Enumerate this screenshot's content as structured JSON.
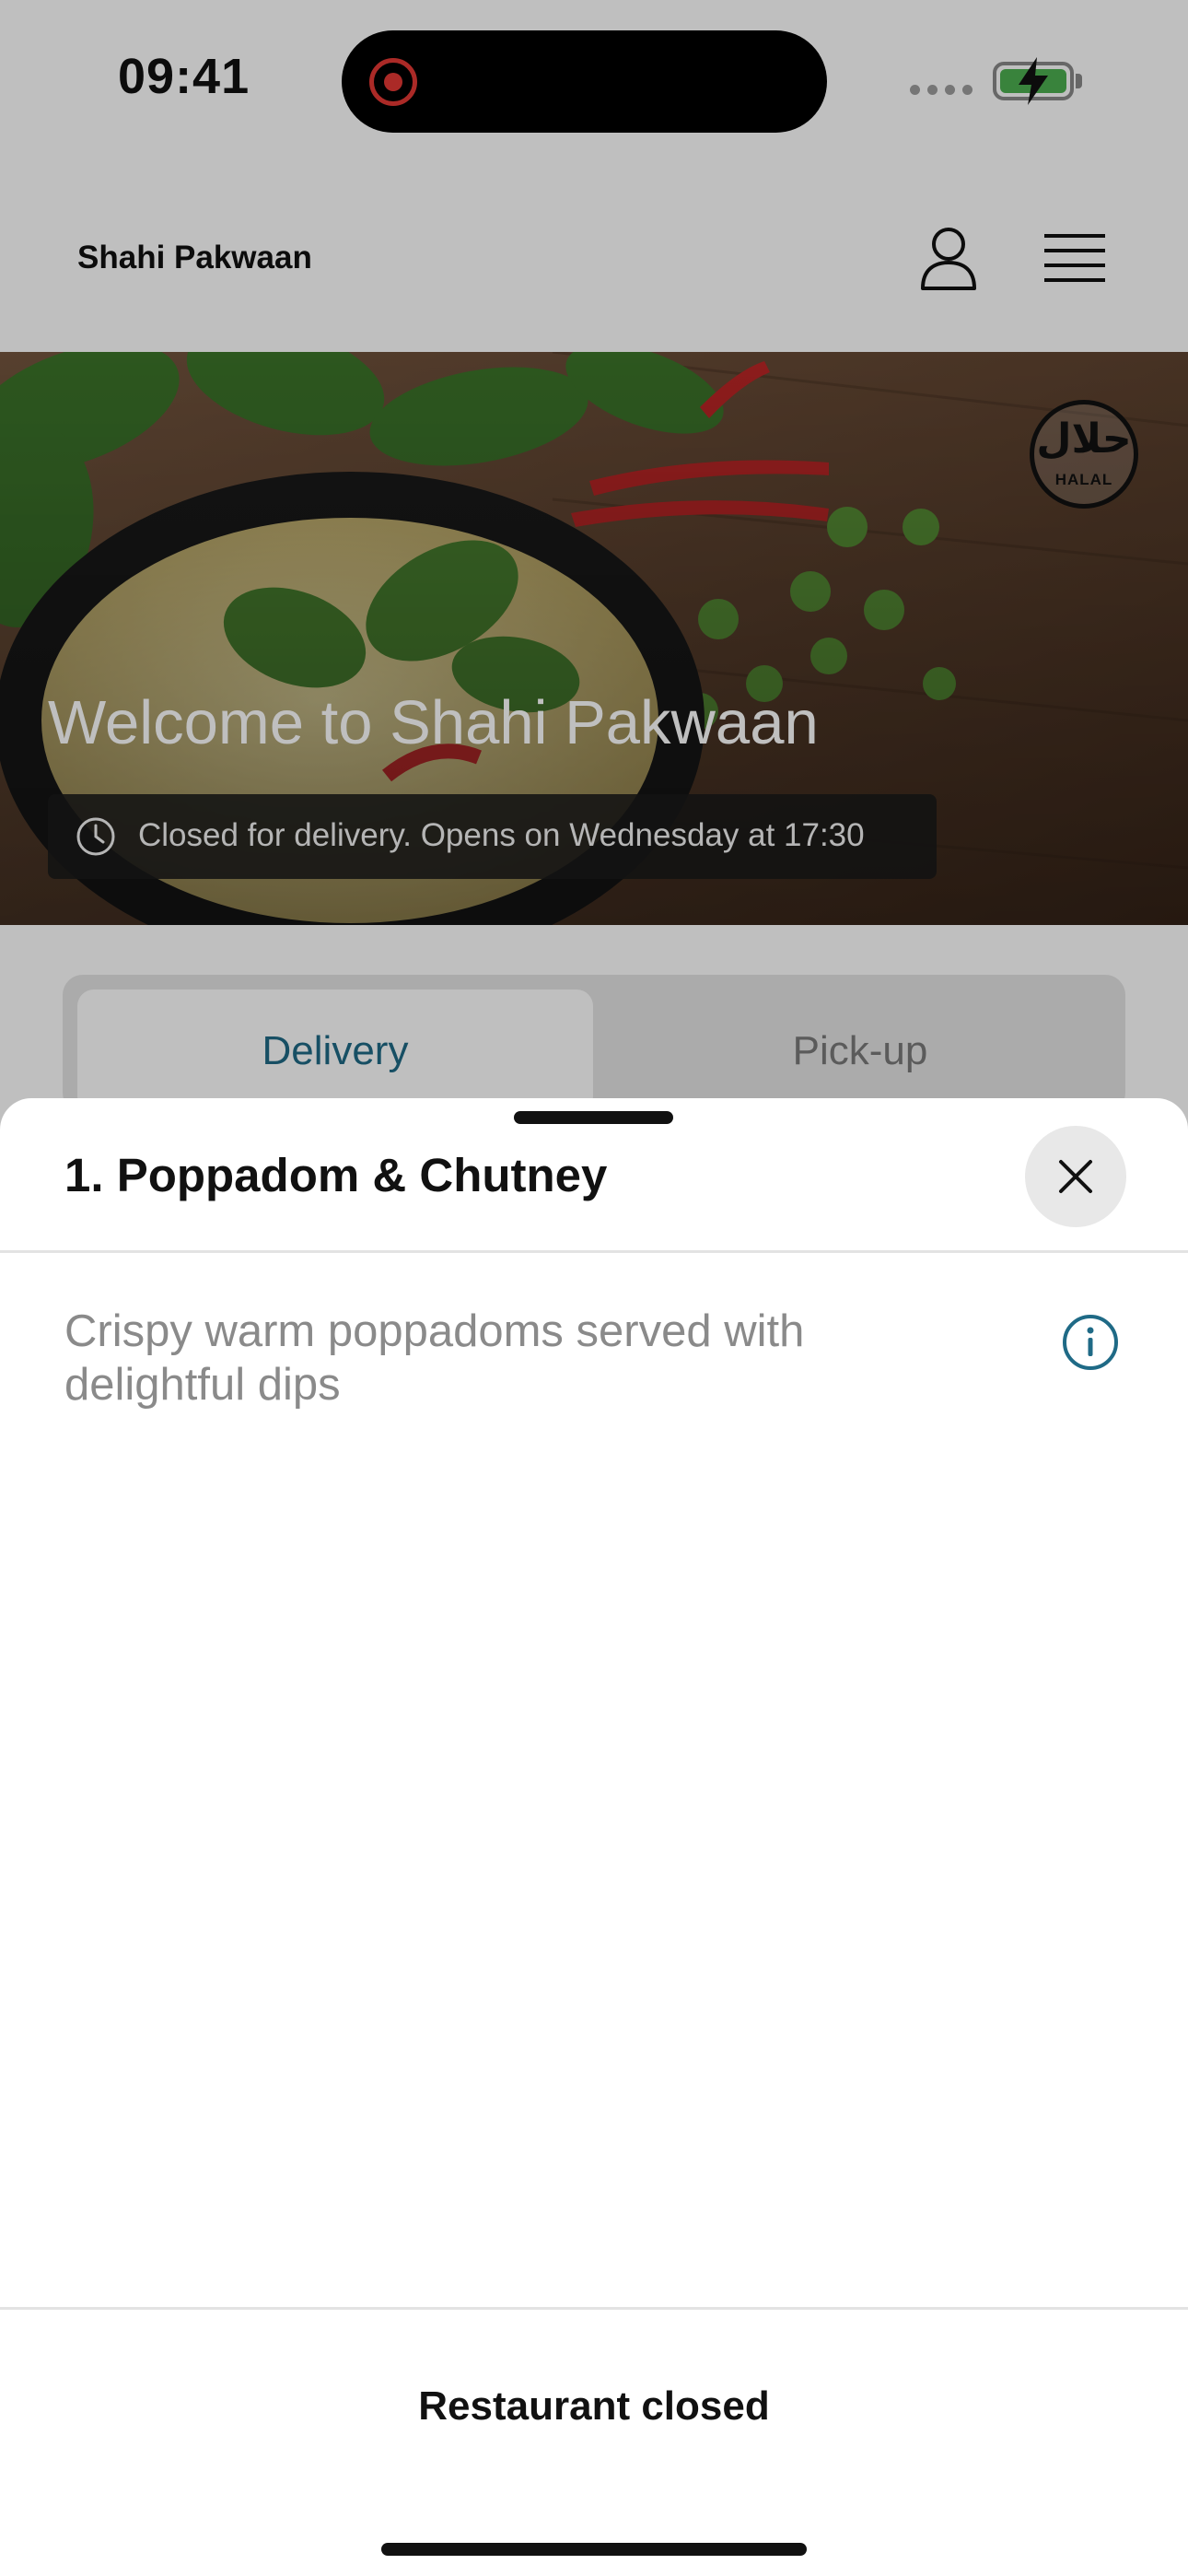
{
  "status_bar": {
    "time": "09:41"
  },
  "header": {
    "restaurant_name": "Shahi Pakwaan"
  },
  "hero": {
    "welcome": "Welcome to Shahi Pakwaan",
    "closed_notice": "Closed for delivery. Opens on Wednesday at 17:30",
    "halal_arabic": "حلال",
    "halal_label": "HALAL"
  },
  "mode_tabs": {
    "delivery": "Delivery",
    "pickup": "Pick-up"
  },
  "sheet": {
    "title": "1. Poppadom & Chutney",
    "description": "Crispy warm poppadoms served with delightful dips",
    "footer_status": "Restaurant closed"
  },
  "colors": {
    "accent": "#1f6a86",
    "battery": "#4caf50",
    "record": "#e53935"
  }
}
